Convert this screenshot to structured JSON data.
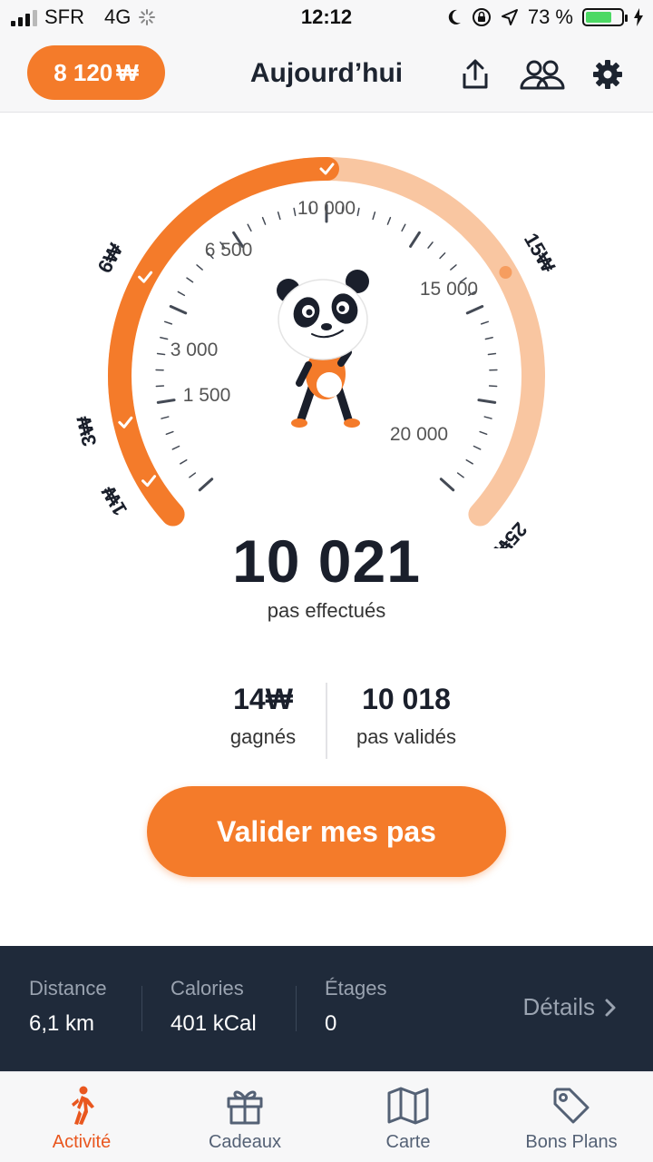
{
  "status_bar": {
    "carrier": "SFR",
    "network": "4G",
    "time": "12:12",
    "battery_text": "73 %",
    "battery_level": 0.73
  },
  "header": {
    "balance": "8 120",
    "currency_symbol": "₩",
    "title": "Aujourd’hui",
    "icons": [
      "share-icon",
      "friends-icon",
      "gear-icon"
    ]
  },
  "gauge": {
    "steps": 10021,
    "max_steps": 25000,
    "milestones": [
      {
        "label": "1₩",
        "steps": 1000,
        "achieved": true
      },
      {
        "label": "3₩",
        "steps": 3000,
        "achieved": true
      },
      {
        "label": "6₩",
        "steps": 6000,
        "achieved": true
      },
      {
        "label": "",
        "steps": 10000,
        "achieved": true
      },
      {
        "label": "15₩",
        "steps": 15000,
        "achieved": false
      },
      {
        "label": "25₩",
        "steps": 25000,
        "achieved": false
      }
    ],
    "scale_labels": [
      "1 500",
      "3 000",
      "6 500",
      "10 000",
      "15 000",
      "20 000"
    ],
    "colors": {
      "progress": "#f47b2a",
      "remaining": "#f9c6a1",
      "ticks": "#444a55"
    }
  },
  "summary": {
    "steps_count": "10 021",
    "steps_label": "pas effectués",
    "earned_value": "14",
    "earned_symbol": "₩",
    "earned_label": "gagnés",
    "validated_value": "10 018",
    "validated_label": "pas validés"
  },
  "validate_button": "Valider mes pas",
  "metrics": [
    {
      "label": "Distance",
      "value": "6,1 km"
    },
    {
      "label": "Calories",
      "value": "401 kCal"
    },
    {
      "label": "Étages",
      "value": "0"
    }
  ],
  "details_label": "Détails",
  "tabs": [
    {
      "label": "Activité",
      "icon": "walking-icon",
      "active": true
    },
    {
      "label": "Cadeaux",
      "icon": "gift-icon",
      "active": false
    },
    {
      "label": "Carte",
      "icon": "map-icon",
      "active": false
    },
    {
      "label": "Bons Plans",
      "icon": "tag-icon",
      "active": false
    }
  ],
  "accent_color": "#f47b2a"
}
